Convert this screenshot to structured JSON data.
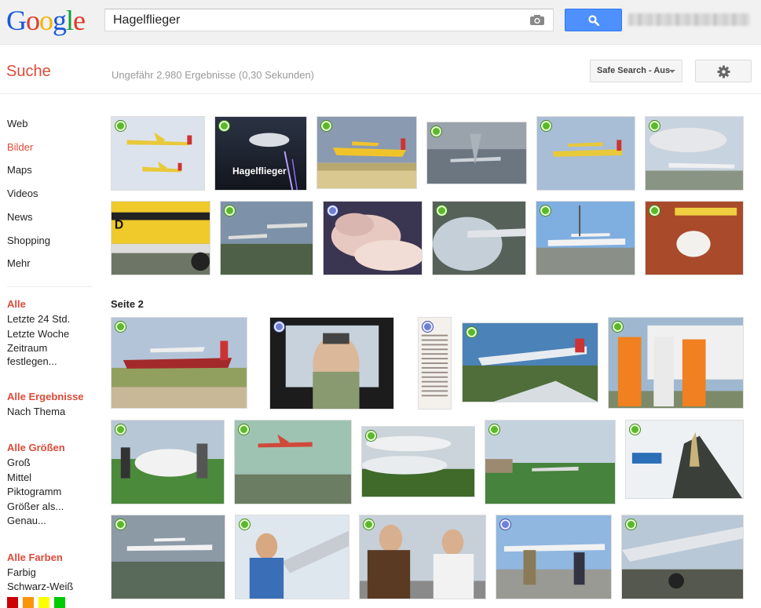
{
  "header": {
    "logo_letters": [
      "G",
      "o",
      "o",
      "g",
      "l",
      "e"
    ],
    "logo_colors": [
      "#1a57d8",
      "#dd3a2a",
      "#f4b400",
      "#1a57d8",
      "#10a03a",
      "#dd3a2a"
    ],
    "search_query": "Hagelflieger",
    "search_button_icon": "search-icon",
    "camera_icon": "camera-icon"
  },
  "subheader": {
    "title": "Suche",
    "result_stats": "Ungefähr 2.980 Ergebnisse (0,30 Sekunden)",
    "safesearch_label": "Safe Search - Aus",
    "settings_icon": "gear-icon"
  },
  "nav": {
    "types": [
      "Web",
      "Bilder",
      "Maps",
      "Videos",
      "News",
      "Shopping",
      "Mehr"
    ],
    "active_type": "Bilder",
    "time_head": "Alle",
    "time_items": [
      "Letzte 24 Std.",
      "Letzte Woche",
      "Zeitraum",
      "festlegen..."
    ],
    "results_head": "Alle Ergebnisse",
    "results_items": [
      "Nach Thema"
    ],
    "size_head": "Alle Größen",
    "size_items": [
      "Groß",
      "Mittel",
      "Piktogramm",
      "Größer als...",
      "Genau..."
    ],
    "color_head": "Alle Farben",
    "color_items": [
      "Farbig",
      "Schwarz-Weiß"
    ],
    "color_swatches": [
      "#cc0000",
      "#fb940b",
      "#ffff00",
      "#00cc00"
    ]
  },
  "results": {
    "page2_label": "Seite 2",
    "hagelflieger_caption": "Hagelflieger"
  },
  "colors": {
    "accent_red": "#dd4b39",
    "button_blue": "#4d90fe"
  }
}
